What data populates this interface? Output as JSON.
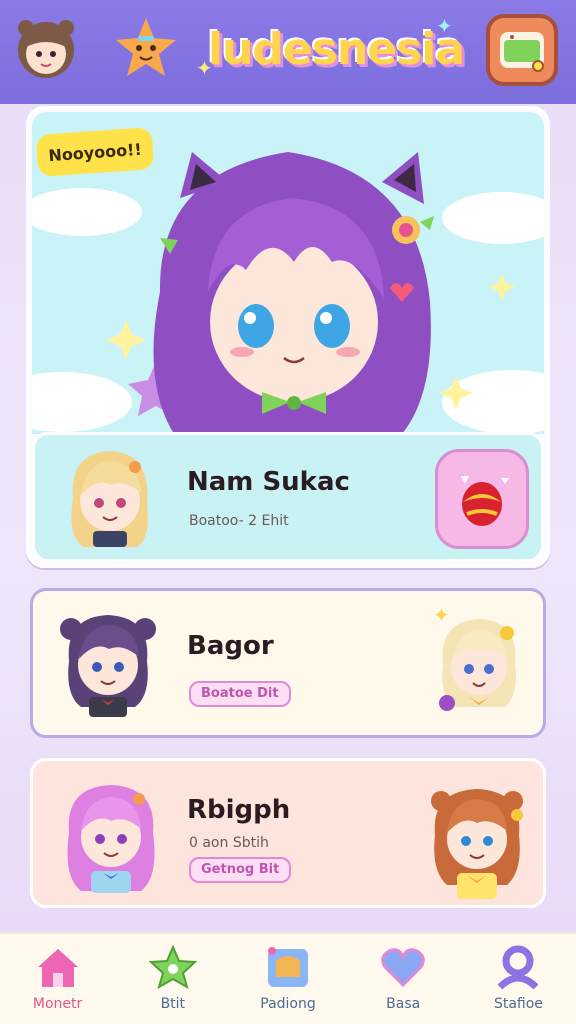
{
  "header": {
    "logo": "ludesnesia"
  },
  "hero": {
    "badge": "Nooyooo!!"
  },
  "featured": {
    "name": "Nam Sukac",
    "subtitle": "Boatoo- 2 Ehit"
  },
  "cards": [
    {
      "name": "Bagor",
      "tag": "Boatoe Dit"
    },
    {
      "name": "Rbigph",
      "subtitle": "0 aon Sbtih",
      "tag": "Getnog Bit"
    }
  ],
  "nav": [
    {
      "label": "Monetr",
      "icon": "home-icon",
      "color": "#ee66b3"
    },
    {
      "label": "Btit",
      "icon": "star-icon",
      "color": "#7fd35a"
    },
    {
      "label": "Padiong",
      "icon": "puzzle-icon",
      "color": "#f3b54f"
    },
    {
      "label": "Basa",
      "icon": "heart-icon",
      "color": "#8ba6f2"
    },
    {
      "label": "Stafioe",
      "icon": "user-icon",
      "color": "#8c73e3"
    }
  ]
}
